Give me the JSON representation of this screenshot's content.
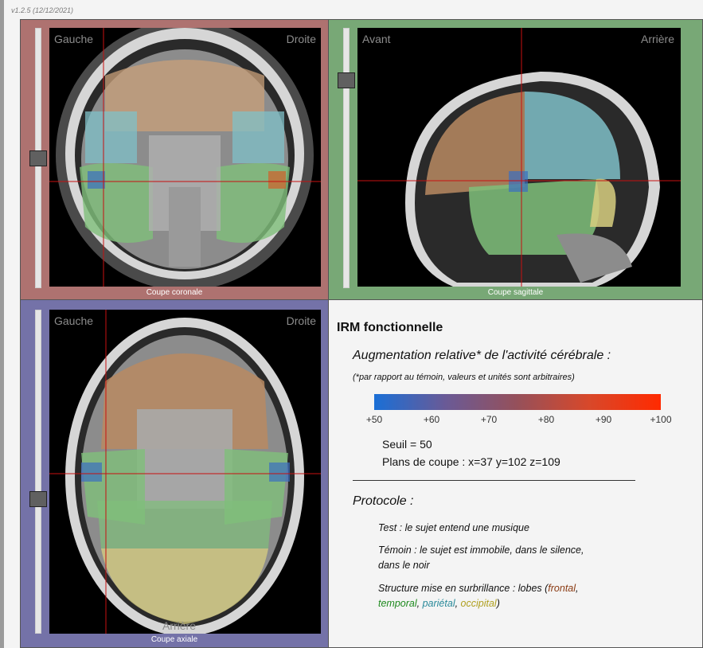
{
  "version": "v1.2.5 (12/12/2021)",
  "coronal": {
    "left": "Gauche",
    "right": "Droite",
    "caption": "Coupe coronale"
  },
  "sagittal": {
    "left": "Avant",
    "right": "Arrière",
    "caption": "Coupe sagittale"
  },
  "axial": {
    "left": "Gauche",
    "right": "Droite",
    "bottom": "Arrière",
    "caption": "Coupe axiale"
  },
  "info": {
    "title": "IRM fonctionnelle",
    "subtitle": "Augmentation relative* de l'activité cérébrale :",
    "note": "(*par rapport au témoin, valeurs et unités sont arbitraires)",
    "scale": {
      "ticks": [
        "+50",
        "+60",
        "+70",
        "+80",
        "+90",
        "+100"
      ],
      "colors": [
        "#1a6fd6",
        "#6a5a96",
        "#96505a",
        "#d8482a",
        "#ff2a00"
      ]
    },
    "seuil": "Seuil = 50",
    "plans": "Plans de coupe : x=37 y=102 z=109",
    "protocol_title": "Protocole :",
    "test": "Test : le sujet entend une musique",
    "temoin_1": "Témoin : le sujet est immobile, dans le silence,",
    "temoin_2": "dans le noir",
    "structure_prefix": "Structure mise en surbrillance : lobes (",
    "lobe_frontal": "frontal",
    "sep1": ",",
    "lobe_temporal": "temporal",
    "sep2": ", ",
    "lobe_parietal": "pariétal",
    "sep3": ", ",
    "lobe_occipital": "occipital",
    "structure_suffix": ")"
  },
  "lobe_colors": {
    "frontal": "#c9a07a",
    "temporal": "#7fbf7a",
    "parietal": "#7fc0c8",
    "occipital": "#d8cf80"
  },
  "crosshair_color": "#c81010"
}
